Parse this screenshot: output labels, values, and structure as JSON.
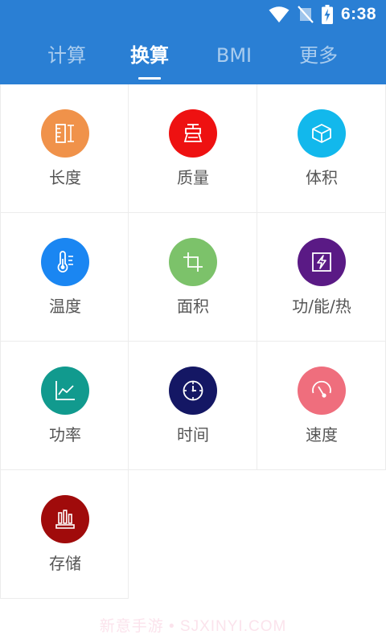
{
  "status_bar": {
    "time": "6:38"
  },
  "tabs": [
    {
      "label": "计算",
      "active": false
    },
    {
      "label": "换算",
      "active": true
    },
    {
      "label": "BMI",
      "active": false
    },
    {
      "label": "更多",
      "active": false
    }
  ],
  "grid": [
    {
      "label": "长度",
      "icon": "ruler-icon",
      "color": "#f0924a"
    },
    {
      "label": "质量",
      "icon": "scale-icon",
      "color": "#ee1111"
    },
    {
      "label": "体积",
      "icon": "cube-icon",
      "color": "#12b8ec"
    },
    {
      "label": "温度",
      "icon": "thermometer-icon",
      "color": "#1a86f2"
    },
    {
      "label": "面积",
      "icon": "crop-icon",
      "color": "#7cc26a"
    },
    {
      "label": "功/能/热",
      "icon": "lightning-icon",
      "color": "#5a1a85"
    },
    {
      "label": "功率",
      "icon": "line-chart-icon",
      "color": "#119a8e"
    },
    {
      "label": "时间",
      "icon": "clock-icon",
      "color": "#141764"
    },
    {
      "label": "速度",
      "icon": "gauge-icon",
      "color": "#ef6e7d"
    },
    {
      "label": "存储",
      "icon": "storage-icon",
      "color": "#a00b0b"
    }
  ],
  "watermark": "新意手游 • SJXINYI.COM"
}
